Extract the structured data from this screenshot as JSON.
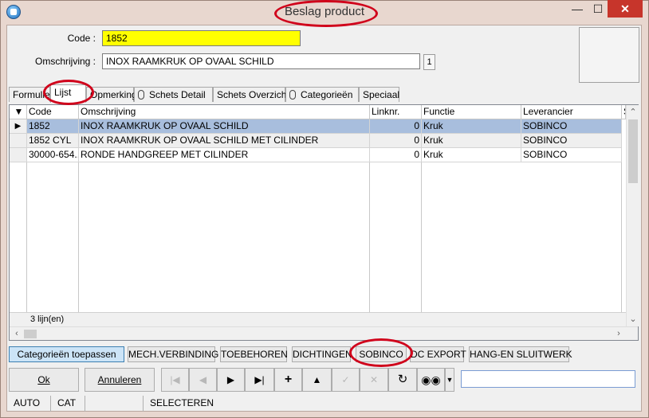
{
  "window": {
    "title": "Beslag product",
    "minimize": "—",
    "maximize": "☐",
    "close": "✕"
  },
  "form": {
    "code_label": "Code :",
    "code_value": "1852",
    "omschrijving_label": "Omschrijving :",
    "omschrijving_value": "INOX RAAMKRUK OP OVAAL SCHILD",
    "count_value": "1"
  },
  "tabs": [
    "Formulier",
    "Lijst",
    "Opmerking",
    "Schets Detail",
    "Schets Overzicht",
    "Categorieën",
    "Speciaal"
  ],
  "grid": {
    "columns": [
      "Code",
      "Omschrijving",
      "Linknr.",
      "Functie",
      "Leverancier",
      "S"
    ],
    "rows": [
      {
        "code": "1852",
        "omschrijving": "INOX RAAMKRUK OP OVAAL SCHILD",
        "linknr": "0",
        "functie": "Kruk",
        "leverancier": "SOBINCO"
      },
      {
        "code": "1852 CYL",
        "omschrijving": "INOX RAAMKRUK OP OVAAL SCHILD MET CILINDER",
        "linknr": "0",
        "functie": "Kruk",
        "leverancier": "SOBINCO"
      },
      {
        "code": "30000-654...",
        "omschrijving": "RONDE HANDGREEP MET CILINDER",
        "linknr": "0",
        "functie": "Kruk",
        "leverancier": "SOBINCO"
      }
    ],
    "footer": "3 lijn(en)"
  },
  "filters": [
    "Categorieën toepassen",
    "MECH.VERBINDING",
    "TOEBEHOREN",
    "DICHTINGEN",
    "SOBINCO",
    "DC EXPORT",
    "HANG-EN SLUITWERK"
  ],
  "toolbar": {
    "ok": "Ok",
    "annuleren": "Annuleren"
  },
  "status": [
    "AUTO",
    "CAT",
    "",
    "SELECTEREN"
  ],
  "colors": {
    "highlight_field": "#ffff00",
    "selected_row": "#a8bedd",
    "annotation": "#d0021b",
    "close_button": "#c7352b"
  }
}
